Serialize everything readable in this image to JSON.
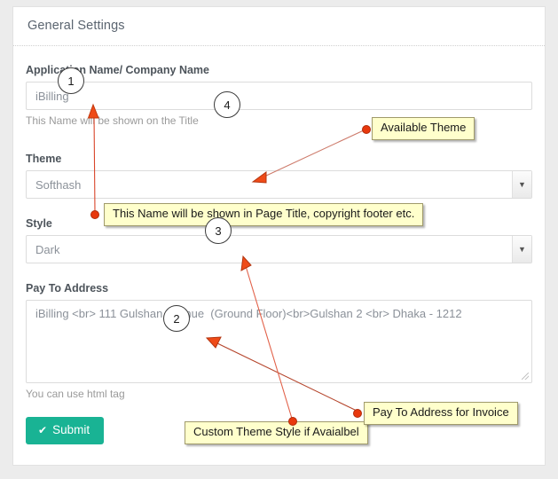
{
  "panel": {
    "title": "General Settings"
  },
  "form": {
    "app_name": {
      "label": "Application Name/ Company Name",
      "value": "iBilling",
      "placeholder": "iBilling",
      "help": "This Name will be shown on the Title"
    },
    "theme": {
      "label": "Theme",
      "value": "Softhash",
      "options": [
        "Softhash"
      ]
    },
    "style": {
      "label": "Style",
      "value": "Dark",
      "options": [
        "Dark"
      ]
    },
    "pay_to_address": {
      "label": "Pay To Address",
      "value": "iBilling <br> 111 Gulshan Avenue  (Ground Floor)<br>Gulshan 2 <br> Dhaka - 1212",
      "help": "You can use html tag"
    },
    "submit": {
      "label": "Submit",
      "icon": "check-icon",
      "color": "#19b394"
    }
  },
  "annotations": {
    "callouts": [
      {
        "id": "available-theme",
        "text": "Available Theme"
      },
      {
        "id": "page-title-note",
        "text": "This Name will be shown in Page Title, copyright footer etc."
      },
      {
        "id": "custom-theme-style",
        "text": "Custom Theme Style if Avaialbel"
      },
      {
        "id": "pay-to-address-invoice",
        "text": "Pay To Address for Invoice"
      }
    ],
    "badges": [
      {
        "id": "badge-1",
        "label": "1"
      },
      {
        "id": "badge-4",
        "label": "4"
      },
      {
        "id": "badge-3",
        "label": "3"
      },
      {
        "id": "badge-2",
        "label": "2"
      }
    ],
    "marker_color": "#e8380d",
    "callout_bg": "#ffffcc"
  }
}
